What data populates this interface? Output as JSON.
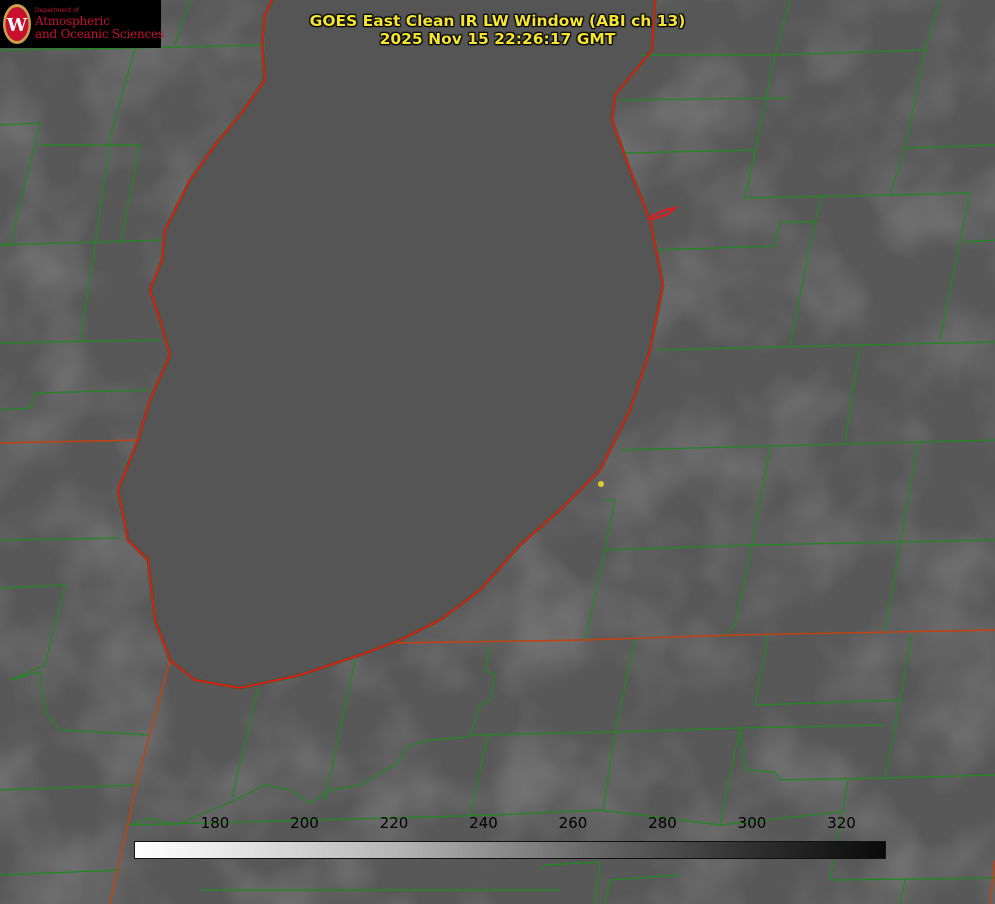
{
  "logo": {
    "department": "Department of",
    "line1": "Atmospheric",
    "line2": "and Oceanic Sciences",
    "seal_letter": "W",
    "icon": "uw-seal-icon"
  },
  "title": {
    "line1": "GOES East Clean IR LW Window (ABI ch 13)",
    "line2": "2025 Nov 15 22:26:17 GMT"
  },
  "colorbar": {
    "ticks": [
      "180",
      "200",
      "220",
      "240",
      "260",
      "280",
      "300",
      "320"
    ],
    "gradient": "white-to-black"
  },
  "colors": {
    "title_text": "#f5e430",
    "county_lines": "#1e8a1e",
    "lake_shoreline": "#e01b1b",
    "state_lines": "#c8400c",
    "site_marker": "#e0cb2a",
    "logo_text": "#c8102e"
  },
  "map": {
    "feature": "lake-michigan-shoreline",
    "marker": "site-marker"
  }
}
